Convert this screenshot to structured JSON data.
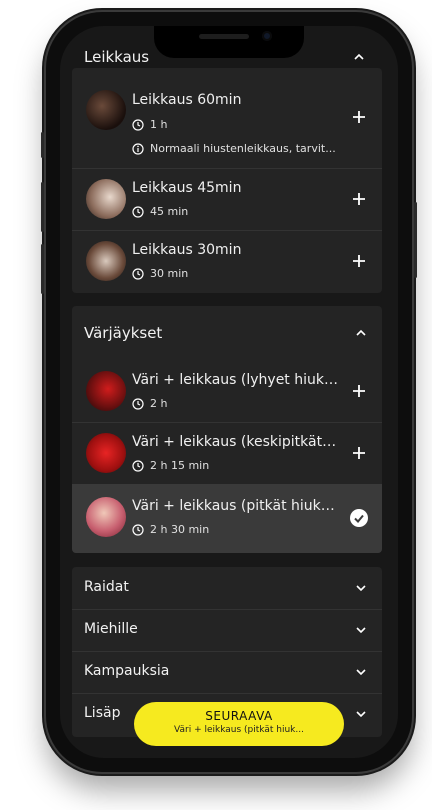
{
  "sections": {
    "leikkaus": {
      "title": "Leikkaus",
      "services": [
        {
          "title": "Leikkaus 60min",
          "duration": "1 h",
          "note": "Normaali hiustenleikkaus, tarvit..."
        },
        {
          "title": "Leikkaus 45min",
          "duration": "45 min"
        },
        {
          "title": "Leikkaus 30min",
          "duration": "30 min"
        }
      ]
    },
    "varjaykset": {
      "title": "Värjäykset",
      "services": [
        {
          "title": "Väri + leikkaus (lyhyet hiukse...",
          "duration": "2 h"
        },
        {
          "title": "Väri + leikkaus (keskipitkät hi...",
          "duration": "2 h 15 min"
        },
        {
          "title": "Väri + leikkaus (pitkät hiukset)",
          "duration": "2 h 30 min"
        }
      ]
    },
    "categories": [
      {
        "label": "Raidat"
      },
      {
        "label": "Miehille"
      },
      {
        "label": "Kampauksia"
      },
      {
        "label": "Lisäp"
      }
    ]
  },
  "cta": {
    "label": "SEURAAVA",
    "sub": "Väri + leikkaus (pitkät hiuk..."
  },
  "colors": {
    "accent": "#f6ea1f",
    "background": "#181818",
    "card": "#242424",
    "selected": "#3a3a3a"
  },
  "icons": [
    "chevron-up-icon",
    "chevron-down-icon",
    "clock-icon",
    "info-icon",
    "plus-icon",
    "check-icon"
  ]
}
